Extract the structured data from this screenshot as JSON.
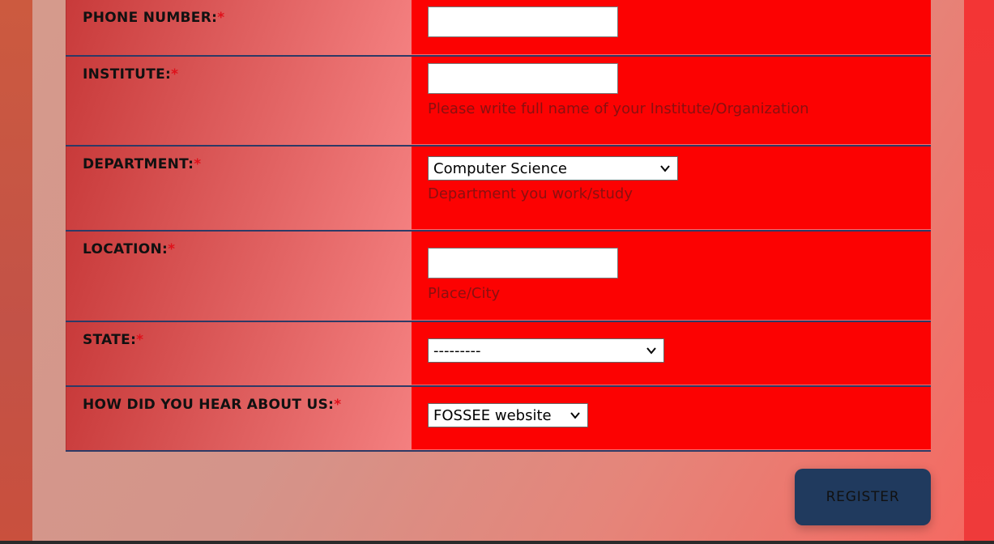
{
  "form": {
    "rows": [
      {
        "label": "PHONE NUMBER:",
        "required": "*",
        "value": ""
      },
      {
        "label": "INSTITUTE:",
        "required": "*",
        "value": "",
        "help": "Please write full name of your Institute/Organization"
      },
      {
        "label": "DEPARTMENT:",
        "required": "*",
        "selected": "Computer Science",
        "help": "Department you work/study"
      },
      {
        "label": "LOCATION:",
        "required": "*",
        "value": "",
        "help": "Place/City"
      },
      {
        "label": "STATE:",
        "required": "*",
        "selected": "---------"
      },
      {
        "label": "HOW DID YOU HEAR ABOUT US:",
        "required": "*",
        "selected": "FOSSEE website"
      }
    ]
  },
  "register_label": "REGISTER",
  "colors": {
    "input_cell_bg": "#fc0202",
    "button_bg": "#203a5e",
    "required_mark": "#e0101a",
    "help_text": "#8a1010"
  }
}
